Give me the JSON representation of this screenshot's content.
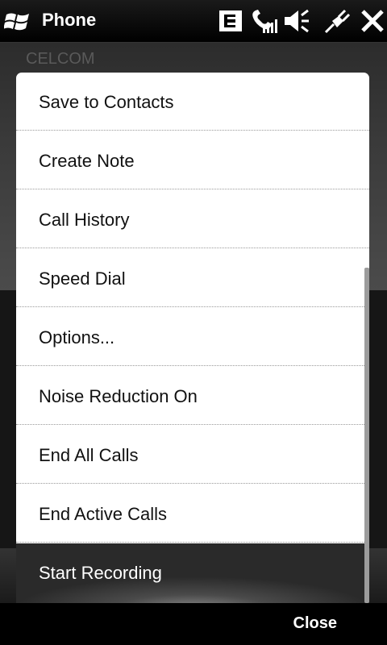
{
  "statusbar": {
    "app_title": "Phone",
    "icons": [
      "windows-start-icon",
      "message-icon",
      "signal-icon",
      "speaker-icon",
      "power-plug-icon",
      "close-icon"
    ]
  },
  "background": {
    "operator": "CELCOM"
  },
  "menu": {
    "items": [
      {
        "label": "Save to Contacts"
      },
      {
        "label": "Create Note"
      },
      {
        "label": "Call History"
      },
      {
        "label": "Speed Dial"
      },
      {
        "label": "Options..."
      },
      {
        "label": "Noise Reduction On"
      },
      {
        "label": "End All Calls"
      },
      {
        "label": "End Active Calls"
      },
      {
        "label": "Start Recording",
        "selected": true
      }
    ]
  },
  "softkeys": {
    "right": "Close"
  },
  "colors": {
    "menu_bg": "#ffffff",
    "selection": "#4a4a4a",
    "bar_bg": "#000000"
  }
}
